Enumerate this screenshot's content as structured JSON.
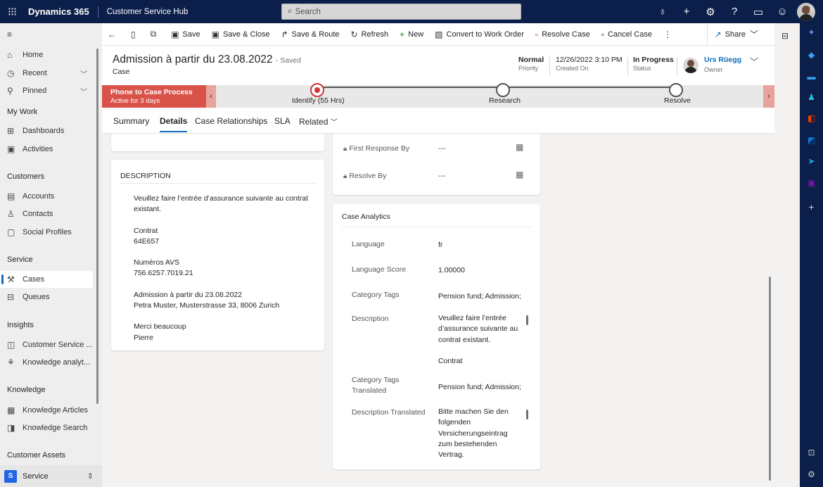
{
  "topbar": {
    "brand": "Dynamics 365",
    "app_name": "Customer Service Hub",
    "search_placeholder": "Search"
  },
  "commandbar": {
    "save": "Save",
    "save_close": "Save & Close",
    "save_route": "Save & Route",
    "refresh": "Refresh",
    "new": "New",
    "convert": "Convert to Work Order",
    "resolve": "Resolve Case",
    "cancel": "Cancel Case",
    "share": "Share"
  },
  "sidebar": {
    "items": [
      {
        "label": "Home"
      },
      {
        "label": "Recent"
      },
      {
        "label": "Pinned"
      }
    ],
    "sections": {
      "my_work": "My Work",
      "customers": "Customers",
      "service": "Service",
      "insights": "Insights",
      "knowledge": "Knowledge",
      "customer_assets": "Customer Assets"
    },
    "my_work": [
      {
        "label": "Dashboards"
      },
      {
        "label": "Activities"
      }
    ],
    "customers": [
      {
        "label": "Accounts"
      },
      {
        "label": "Contacts"
      },
      {
        "label": "Social Profiles"
      }
    ],
    "service": [
      {
        "label": "Cases"
      },
      {
        "label": "Queues"
      }
    ],
    "insights": [
      {
        "label": "Customer Service ..."
      },
      {
        "label": "Knowledge analyt..."
      }
    ],
    "knowledge": [
      {
        "label": "Knowledge Articles"
      },
      {
        "label": "Knowledge Search"
      }
    ],
    "area": {
      "letter": "S",
      "label": "Service"
    }
  },
  "header": {
    "title": "Admission à partir du 23.08.2022",
    "saved": "- Saved",
    "entity": "Case",
    "priority_value": "Normal",
    "priority_label": "Priority",
    "created_value": "12/26/2022 3:10 PM",
    "created_label": "Created On",
    "status_value": "In Progress",
    "status_label": "Status",
    "owner_value": "Urs Rüegg",
    "owner_label": "Owner"
  },
  "bpf": {
    "process_name": "Phone to Case Process",
    "active_for": "Active for 3 days",
    "stages": [
      {
        "label": "Identify  (55 Hrs)"
      },
      {
        "label": "Research"
      },
      {
        "label": "Resolve"
      }
    ]
  },
  "tabs": [
    {
      "label": "Summary"
    },
    {
      "label": "Details"
    },
    {
      "label": "Case Relationships"
    },
    {
      "label": "SLA"
    },
    {
      "label": "Related"
    }
  ],
  "description": {
    "title": "DESCRIPTION",
    "lines": [
      "Veuillez faire l’entrée d’assurance suivante au contrat existant.",
      "Contrat",
      "64E657",
      "Numéros AVS",
      "756.6257.7019.21",
      "Admission à partir du 23.08.2022",
      "Petra Muster, Musterstrasse 33, 8006 Zurich",
      "Merci beaucoup",
      "Pierre"
    ]
  },
  "sla": {
    "first_response_label": "First Response By",
    "first_response_value": "---",
    "resolve_label": "Resolve By",
    "resolve_value": "---"
  },
  "analytics": {
    "title": "Case Analytics",
    "language_label": "Language",
    "language_value": "fr",
    "score_label": "Language Score",
    "score_value": "1.00000",
    "tags_label": "Category Tags",
    "tags_value": "Pension fund; Admission;",
    "desc_label": "Description",
    "desc_value_1": "Veuillez faire l’entrée d’assurance suivante au contrat existant.",
    "desc_value_2": "Contrat",
    "tags_tr_label": "Category Tags Translated",
    "tags_tr_value": "Pension fund; Admission;",
    "desc_tr_label": "Description Translated",
    "desc_tr_value": "Bitte machen Sie den folgenden Versicherungseintrag zum bestehenden Vertrag."
  },
  "colors": {
    "topbar": "#0b1f4a",
    "accent": "#0f6cbd",
    "bpf_active": "#d9534a"
  }
}
